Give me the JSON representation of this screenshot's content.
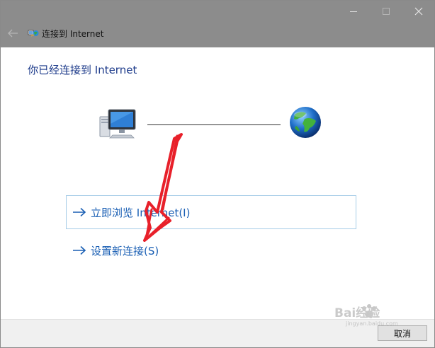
{
  "window": {
    "title": "连接到 Internet",
    "controls": [
      "minimize",
      "maximize",
      "close"
    ]
  },
  "main": {
    "heading": "你已经连接到 Internet",
    "diagram": {
      "left_icon": "computer-monitor-icon",
      "right_icon": "globe-icon"
    },
    "options": [
      {
        "label": "立即浏览 Internet(I)",
        "icon": "arrow-right-icon"
      },
      {
        "label": "设置新连接(S)",
        "icon": "arrow-right-icon"
      }
    ]
  },
  "footer": {
    "cancel_label": "取消"
  },
  "colors": {
    "titlebar": "#8c8c8c",
    "heading": "#1c3a8a",
    "link": "#1a5fb4",
    "option_border": "#a7cde8",
    "annotation": "#e8202a"
  },
  "overlay": {
    "annotation": "red-arrow-annotation",
    "watermark_text": "Bai经验",
    "watermark_subtext": "jingyan.baidu.com"
  }
}
